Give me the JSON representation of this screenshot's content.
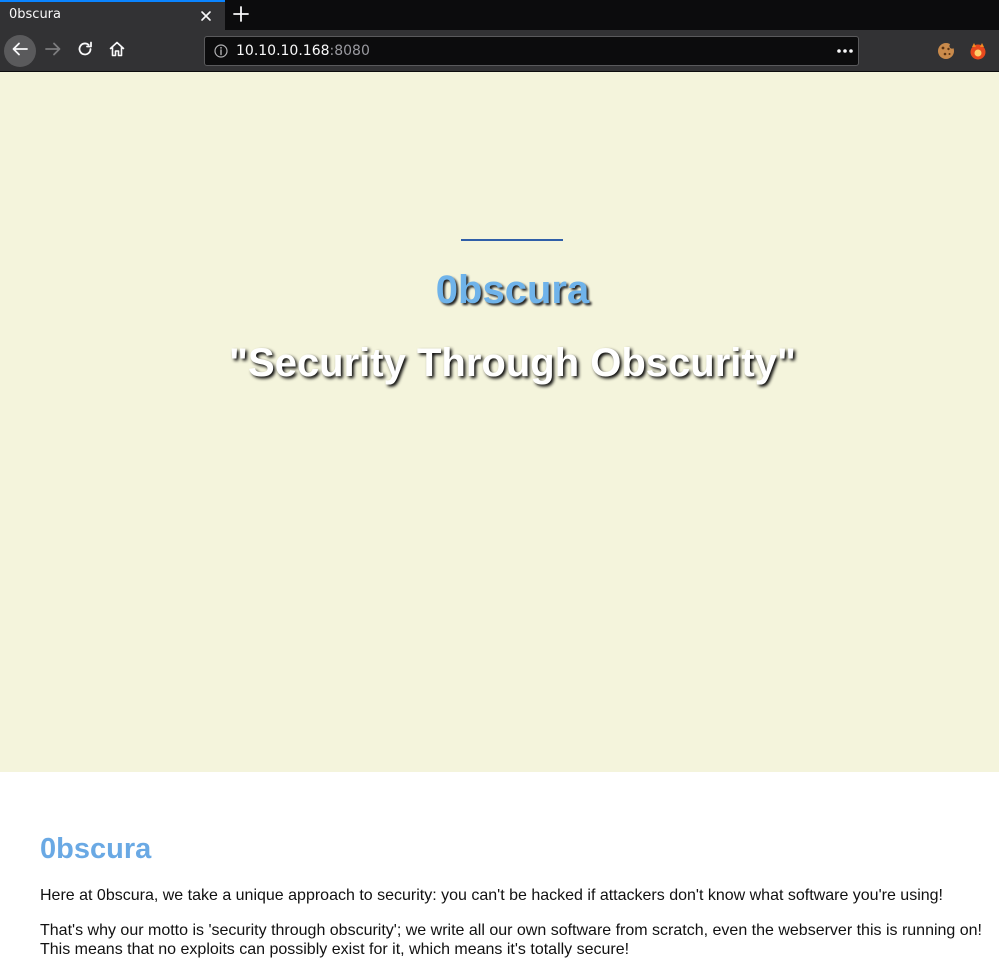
{
  "browser": {
    "tab": {
      "title": "0bscura"
    },
    "url": {
      "host": "10.10.10.168",
      "port": ":8080"
    },
    "icons": {
      "close": "close-icon",
      "new_tab": "plus-icon",
      "back": "arrow-left-icon",
      "forward": "arrow-right-icon",
      "reload": "reload-icon",
      "home": "home-icon",
      "info": "info-icon",
      "menu": "more-horizontal-icon",
      "extension_1": "cookie-icon",
      "extension_2": "firefox-extension-icon"
    },
    "colors": {
      "chrome_dark": "#0c0c0d",
      "chrome_mid": "#323234",
      "tab_accent": "#0a84ff"
    }
  },
  "page": {
    "hero": {
      "title": "0bscura",
      "motto": "\"Security Through Obscurity\""
    },
    "content": {
      "heading": "0bscura",
      "paragraph_1": "Here at 0bscura, we take a unique approach to security: you can't be hacked if attackers don't know what software you're using!",
      "paragraph_2_line_1": "That's why our motto is 'security through obscurity'; we write all our own software from scratch, even the webserver this is running on!",
      "paragraph_2_line_2": "This means that no exploits can possibly exist for it, which means it's totally secure!"
    },
    "colors": {
      "hero_background": "#f4f4dc",
      "accent_blue": "#6aa9e4",
      "rule_blue": "#2f5ea8"
    }
  }
}
